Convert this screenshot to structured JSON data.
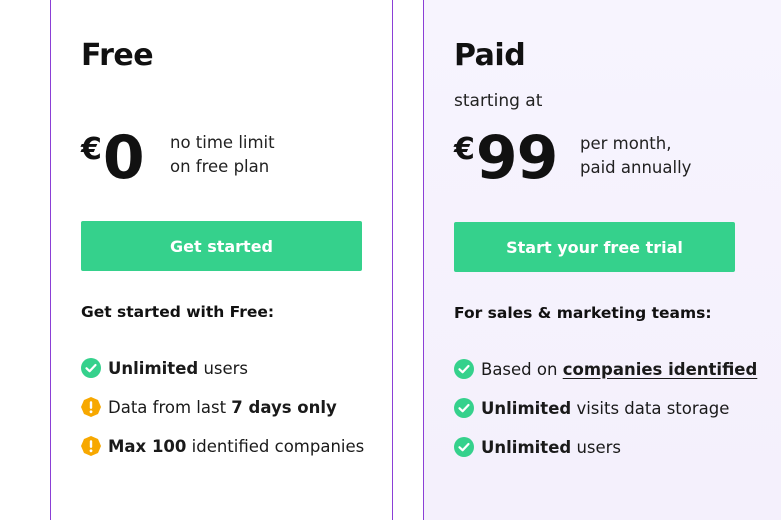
{
  "free": {
    "title": "Free",
    "currency": "€",
    "amount": "0",
    "note_line1": "no time limit",
    "note_line2": "on free plan",
    "cta_label": "Get started",
    "features_heading": "Get started with Free:",
    "features": [
      {
        "icon": "check-circle-icon",
        "bold": "Unlimited",
        "text": " users"
      },
      {
        "icon": "warning-circle-icon",
        "prefix": "Data from last ",
        "bold": "7 days only"
      },
      {
        "icon": "warning-circle-icon",
        "bold": "Max 100",
        "text": " identified companies"
      }
    ]
  },
  "paid": {
    "title": "Paid",
    "subtitle": "starting at",
    "currency": "€",
    "amount": "99",
    "note_line1": "per month,",
    "note_line2": "paid annually",
    "cta_label": "Start your free trial",
    "features_heading": "For sales & marketing teams:",
    "features": [
      {
        "icon": "check-circle-icon",
        "prefix": "Based on ",
        "link": "companies identified"
      },
      {
        "icon": "check-circle-icon",
        "bold": "Unlimited",
        "text": " visits data storage"
      },
      {
        "icon": "check-circle-icon",
        "bold": "Unlimited",
        "text": " users"
      }
    ]
  },
  "colors": {
    "accent_green": "#35d18c",
    "warning_orange": "#f7a800",
    "card_border": "#8b3fd6",
    "paid_background": "#f6f2fd"
  }
}
